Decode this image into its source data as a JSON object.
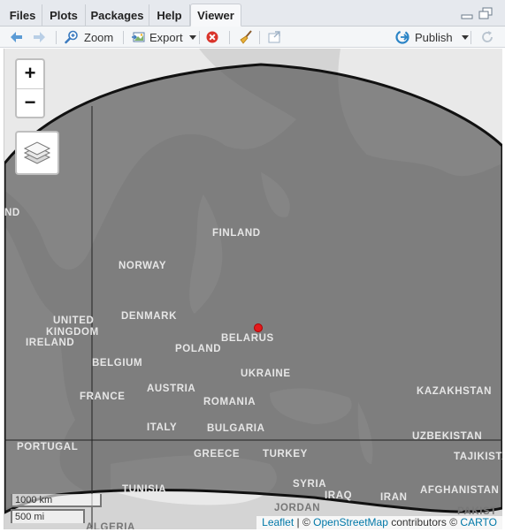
{
  "tabs": [
    "Files",
    "Plots",
    "Packages",
    "Help",
    "Viewer"
  ],
  "active_tab": "Viewer",
  "toolbar": {
    "zoom": "Zoom",
    "export": "Export",
    "publish": "Publish"
  },
  "map": {
    "zoom_in": "+",
    "zoom_out": "−",
    "labels": {
      "ireland_left": "ND",
      "finland": "FINLAND",
      "norway": "NORWAY",
      "denmark": "DENMARK",
      "united": "UNITED",
      "kingdom": "KINGDOM",
      "ireland": "IRELAND",
      "belarus": "BELARUS",
      "poland": "POLAND",
      "belgium": "BELGIUM",
      "ukraine": "UKRAINE",
      "austria": "AUSTRIA",
      "france": "FRANCE",
      "romania": "ROMANIA",
      "kazakhstan": "KAZAKHSTAN",
      "italy": "ITALY",
      "bulgaria": "BULGARIA",
      "portugal": "PORTUGAL",
      "uzbekistan": "UZBEKISTAN",
      "greece": "GREECE",
      "turkey": "TURKEY",
      "tajikistan": "TAJIKISTA",
      "tunisia": "TUNISIA",
      "syria": "SYRIA",
      "iraq": "IRAQ",
      "iran": "IRAN",
      "afghanistan": "AFGHANISTAN",
      "jordan": "JORDAN",
      "algeria": "ALGERIA",
      "pakistan": "PAKIST"
    },
    "scale_km": "1000 km",
    "scale_mi": "500 mi",
    "attribution": {
      "leaflet": "Leaflet",
      "sep": " | © ",
      "osm": "OpenStreetMap",
      "contrib": " contributors © ",
      "carto": "CARTO"
    },
    "colors": {
      "land": "#d4d4d4",
      "water": "#e9e9e9",
      "shade": "#555555",
      "marker": "#e31a1c"
    }
  }
}
